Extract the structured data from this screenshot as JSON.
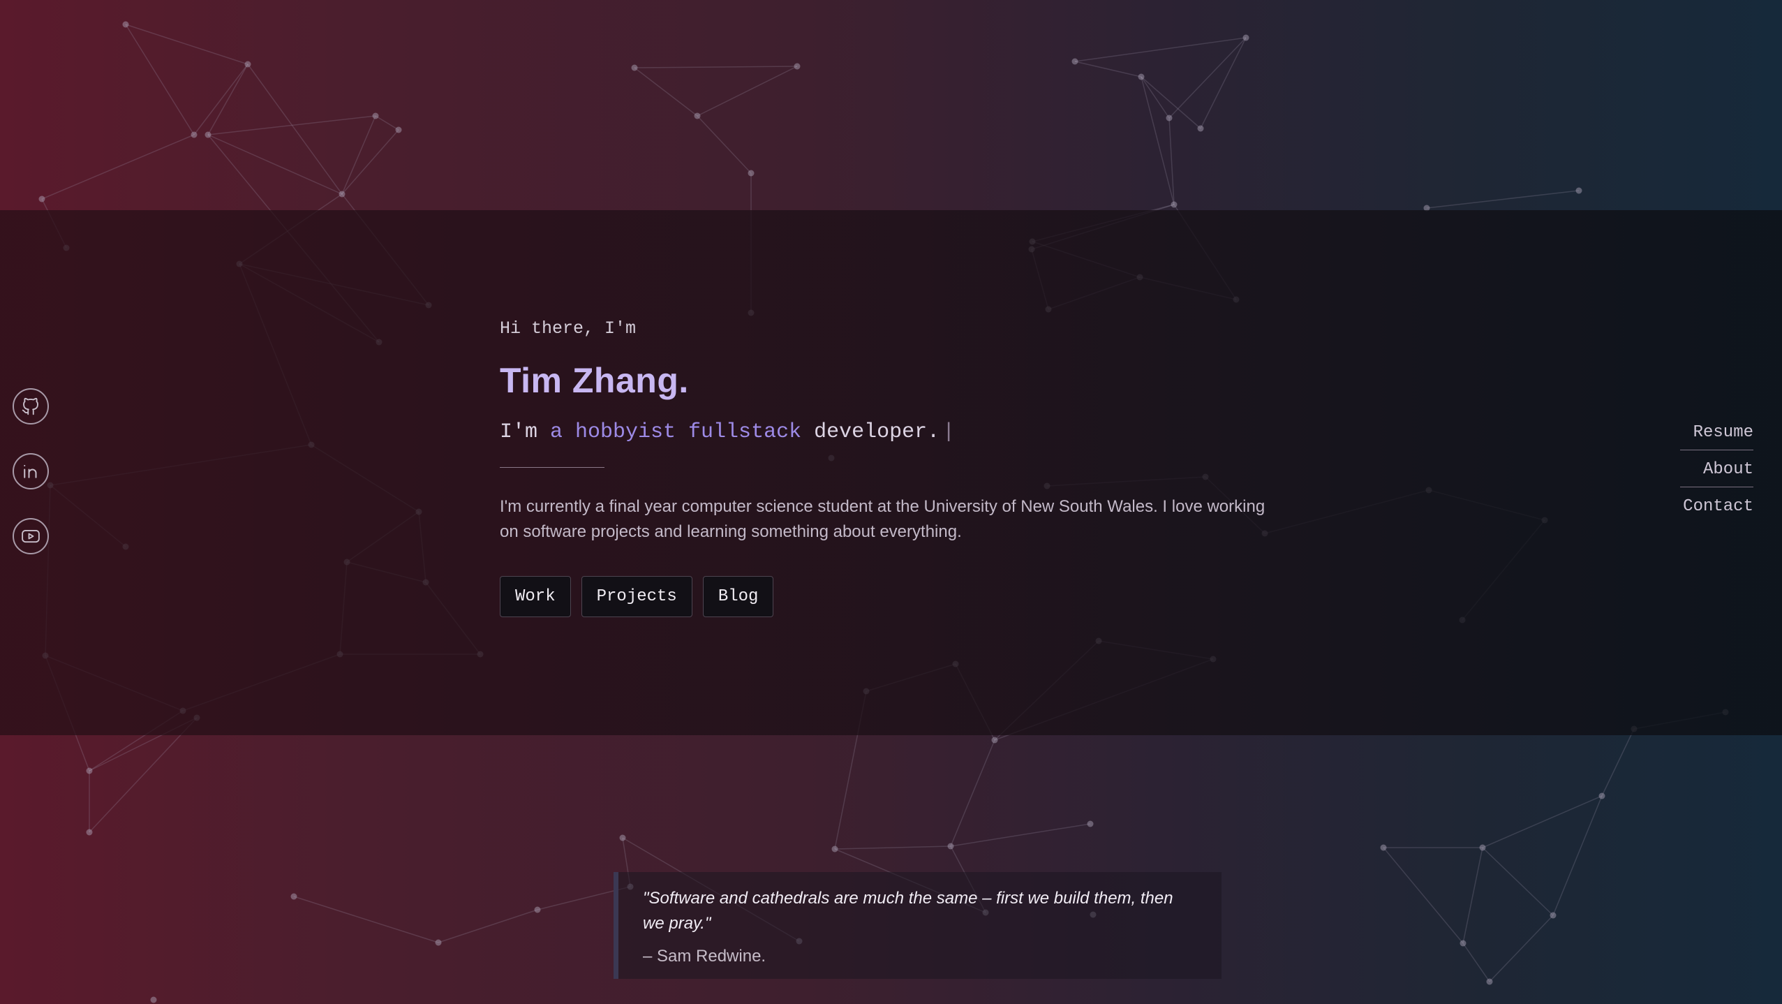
{
  "social": [
    {
      "name": "github",
      "icon": "github-icon"
    },
    {
      "name": "linkedin",
      "icon": "linkedin-icon"
    },
    {
      "name": "youtube",
      "icon": "youtube-icon"
    }
  ],
  "nav": {
    "items": [
      "Resume",
      "About",
      "Contact"
    ]
  },
  "hero": {
    "greeting": "Hi there, I'm",
    "name": "Tim Zhang.",
    "tagline_prefix": "I'm ",
    "tagline_accent": "a hobbyist fullstack",
    "tagline_suffix": " developer.",
    "cursor": "|",
    "bio": "I'm currently a final year computer science student at the University of New South Wales. I love working on software projects and learning something about everything.",
    "buttons": [
      "Work",
      "Projects",
      "Blog"
    ]
  },
  "quote": {
    "text": "\"Software and cathedrals are much the same – first we build them, then we pray.\"",
    "author": "– Sam Redwine."
  },
  "colors": {
    "accent": "#c8b7f2",
    "accent_secondary": "#9d8ae6",
    "background_left": "#5a1a2c",
    "background_right": "#16293a"
  }
}
